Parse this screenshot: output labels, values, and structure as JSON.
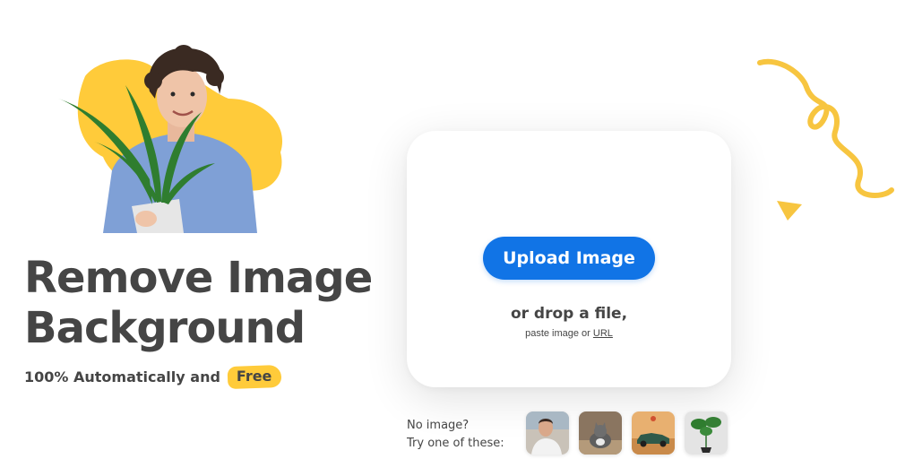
{
  "hero": {
    "headline_line1": "Remove Image",
    "headline_line2": "Background",
    "subline_prefix": "100% Automatically and",
    "subline_badge": "Free"
  },
  "upload": {
    "button_label": "Upload Image",
    "drop_text": "or drop a file,",
    "paste_prefix": "paste image or",
    "url_link": "URL"
  },
  "samples": {
    "label_line1": "No image?",
    "label_line2": "Try one of these:",
    "items": [
      "person-sample",
      "cat-sample",
      "car-sample",
      "plant-sample"
    ]
  },
  "colors": {
    "accent_blue": "#1174e6",
    "accent_yellow": "#ffcb3a",
    "text": "#454545"
  },
  "icons": [
    "squiggle-decoration",
    "triangle-decoration",
    "yellow-blob"
  ]
}
